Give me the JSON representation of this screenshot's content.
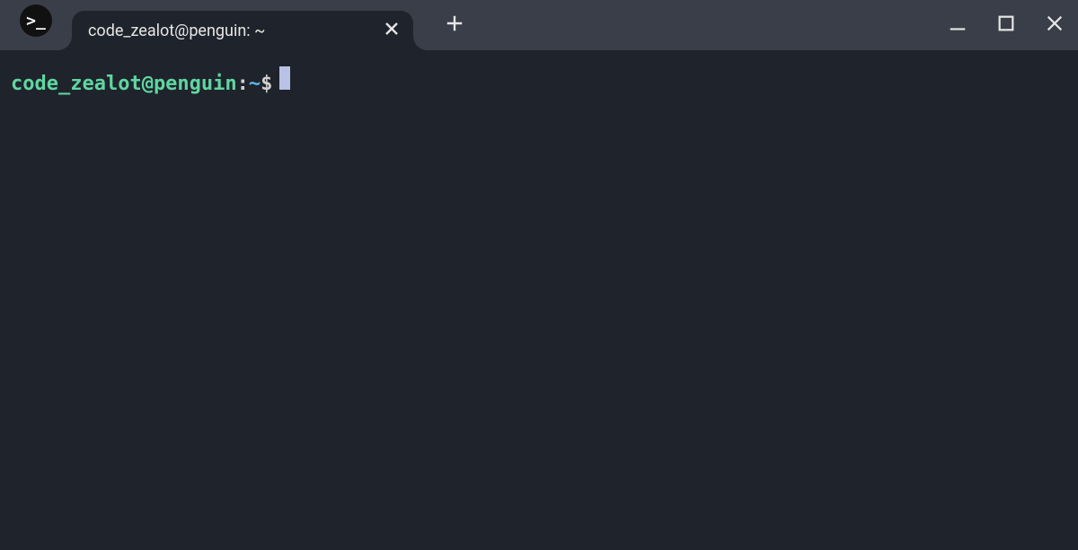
{
  "tab_title": "code_zealot@penguin: ~",
  "app_icon_glyph": ">_",
  "prompt": {
    "user_host": "code_zealot@penguin",
    "separator": ":",
    "path": "~",
    "symbol": "$"
  }
}
